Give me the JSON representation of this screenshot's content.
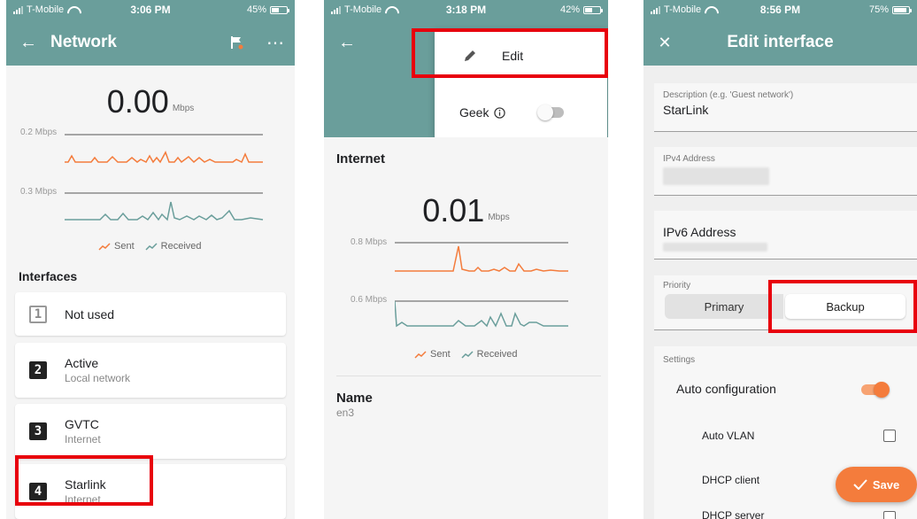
{
  "colors": {
    "teal": "#6a9e9b",
    "orange": "#f47c3c",
    "highlight_red": "#e8000c"
  },
  "panel1": {
    "status": {
      "carrier": "T-Mobile",
      "time": "3:06 PM",
      "battery": "45%",
      "battery_level": 0.45
    },
    "appbar": {
      "title": "Network",
      "back_icon": "back-arrow-icon",
      "flag_icon": "flag-icon",
      "more_icon": "more-horizontal-icon"
    },
    "speed": {
      "value": "0.00",
      "unit": "Mbps"
    },
    "sent_chart": {
      "label": "0.2 Mbps"
    },
    "received_chart": {
      "label": "0.3 Mbps"
    },
    "legend": {
      "sent": "Sent",
      "received": "Received"
    },
    "interfaces_title": "Interfaces",
    "interfaces": [
      {
        "num": "1",
        "name": "Not used",
        "sub": ""
      },
      {
        "num": "2",
        "name": "Active",
        "sub": "Local network"
      },
      {
        "num": "3",
        "name": "GVTC",
        "sub": "Internet"
      },
      {
        "num": "4",
        "name": "Starlink",
        "sub": "Internet"
      }
    ]
  },
  "panel2": {
    "status": {
      "carrier": "T-Mobile",
      "time": "3:18 PM",
      "battery": "42%",
      "battery_level": 0.42
    },
    "menu": {
      "edit": "Edit",
      "geek": "Geek",
      "edit_icon": "pencil-icon",
      "info_icon": "info-icon"
    },
    "section_title": "Internet",
    "speed": {
      "value": "0.01",
      "unit": "Mbps"
    },
    "sent_chart": {
      "label": "0.8 Mbps"
    },
    "received_chart": {
      "label": "0.6 Mbps"
    },
    "legend": {
      "sent": "Sent",
      "received": "Received"
    },
    "name_label": "Name",
    "name_value": "en3"
  },
  "panel3": {
    "status": {
      "carrier": "T-Mobile",
      "time": "8:56 PM",
      "battery": "75%",
      "battery_level": 0.75
    },
    "appbar": {
      "title": "Edit interface",
      "close_icon": "close-icon"
    },
    "description": {
      "label": "Description (e.g. 'Guest network')",
      "value": "StarLink"
    },
    "ipv4": {
      "label": "IPv4 Address"
    },
    "ipv6": {
      "label": "IPv6 Address"
    },
    "priority": {
      "label": "Priority",
      "primary": "Primary",
      "backup": "Backup",
      "selected": "Backup"
    },
    "settings": {
      "label": "Settings",
      "auto_config": "Auto configuration",
      "auto_vlan": "Auto VLAN",
      "dhcp_client": "DHCP client",
      "dhcp_server": "DHCP server"
    },
    "save_button": "Save"
  }
}
